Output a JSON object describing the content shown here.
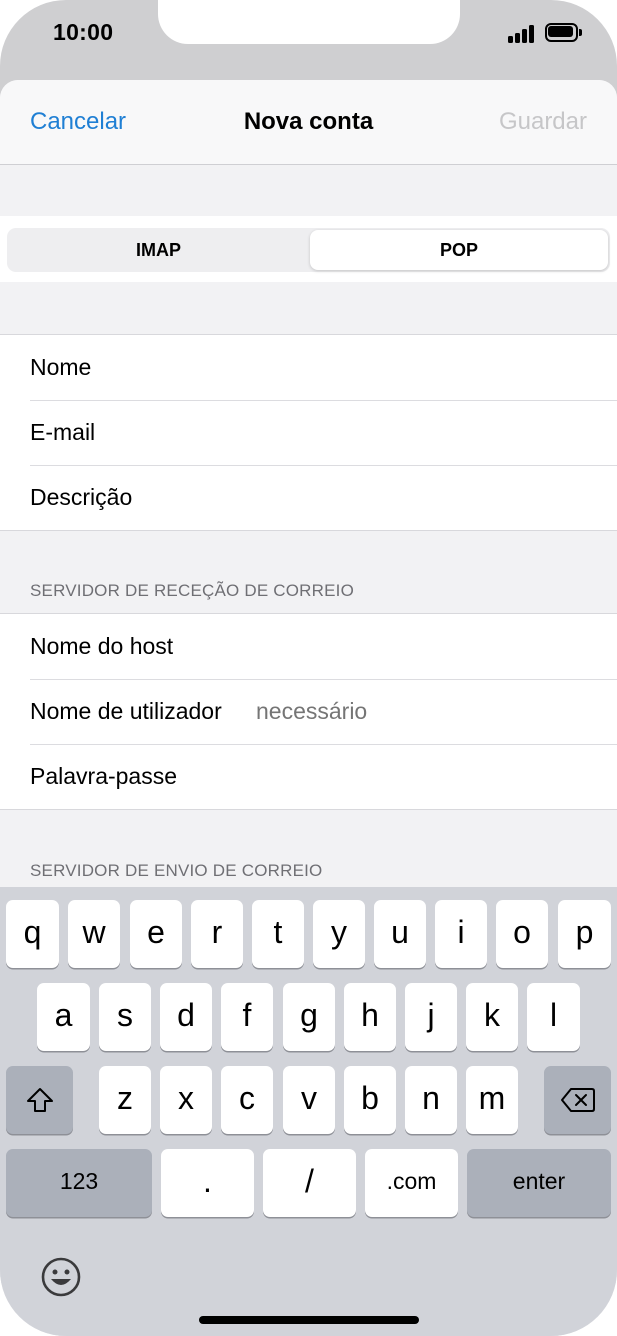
{
  "status_bar": {
    "time": "10:00"
  },
  "nav": {
    "cancel": "Cancelar",
    "title": "Nova conta",
    "save": "Guardar"
  },
  "segmented": {
    "options": [
      "IMAP",
      "POP"
    ],
    "selected": "POP"
  },
  "account_fields": [
    {
      "label": "Nome"
    },
    {
      "label": "E-mail"
    },
    {
      "label": "Descrição"
    }
  ],
  "incoming": {
    "header": "SERVIDOR DE RECEÇÃO DE CORREIO",
    "fields": [
      {
        "label": "Nome do host",
        "placeholder": ""
      },
      {
        "label": "Nome de utilizador",
        "placeholder": "necessário"
      },
      {
        "label": "Palavra-passe",
        "placeholder": ""
      }
    ]
  },
  "outgoing": {
    "header": "SERVIDOR DE ENVIO DE CORREIO"
  },
  "keyboard": {
    "row1": [
      "q",
      "w",
      "e",
      "r",
      "t",
      "y",
      "u",
      "i",
      "o",
      "p"
    ],
    "row2": [
      "a",
      "s",
      "d",
      "f",
      "g",
      "h",
      "j",
      "k",
      "l"
    ],
    "row3": [
      "z",
      "x",
      "c",
      "v",
      "b",
      "n",
      "m"
    ],
    "numbers": "123",
    "dot": ".",
    "slash": "/",
    "dotcom": ".com",
    "enter": "enter"
  },
  "colors": {
    "accent": "#1f7fd4",
    "disabled": "#c6c6c8",
    "keyboard_bg": "#d1d3d9"
  },
  "icons": [
    "signal-icon",
    "battery-icon",
    "shift-icon",
    "backspace-icon",
    "emoji-icon"
  ]
}
